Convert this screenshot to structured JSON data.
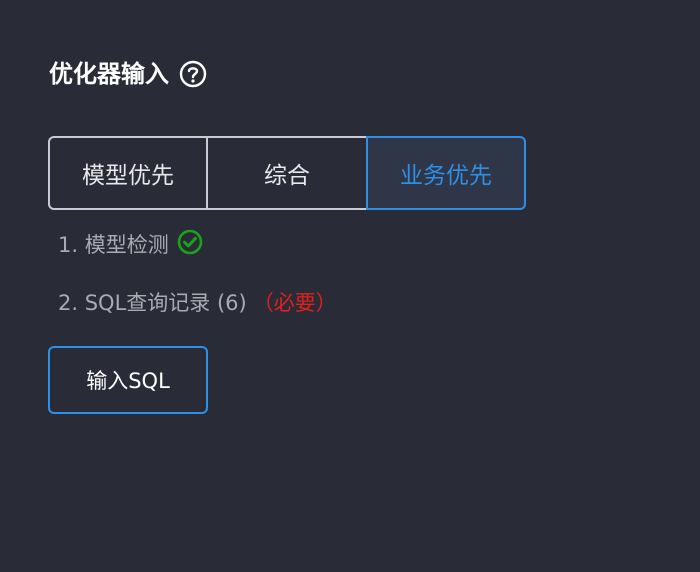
{
  "header": {
    "title": "优化器输入",
    "help_icon": "question-circle-icon"
  },
  "modes": {
    "options": [
      "模型优先",
      "综合",
      "业务优先"
    ],
    "selected": "业务优先",
    "accent_color": "#2e8fe6"
  },
  "steps": [
    {
      "label": "1. 模型检测",
      "status_icon": "check-circle-icon",
      "status_color": "#1aa31a"
    },
    {
      "label": "2. SQL查询记录 (6)",
      "required_label": "（必要）",
      "required_color": "#e0201c"
    }
  ],
  "actions": {
    "input_sql_label": "输入SQL"
  }
}
